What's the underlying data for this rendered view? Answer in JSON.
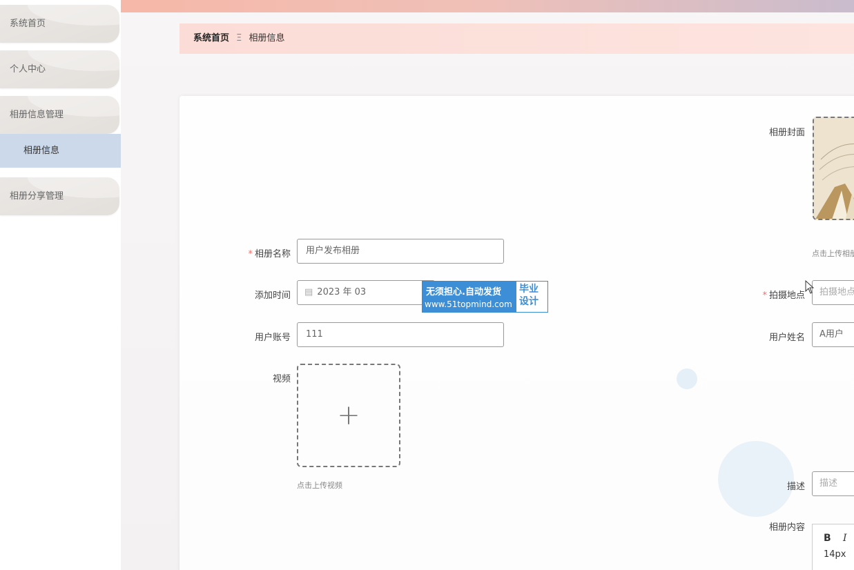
{
  "sidebar": {
    "items": [
      {
        "label": "系统首页"
      },
      {
        "label": "个人中心",
        "chevron": "chevron-down-icon"
      },
      {
        "label": "相册信息管理",
        "chevron": "chevron-up-icon"
      },
      {
        "label": "相册分享管理",
        "chevron": "chevron-down-icon"
      }
    ],
    "active_sub": "相册信息"
  },
  "breadcrumb": {
    "home": "系统首页",
    "separator": "Ξ",
    "current": "相册信息"
  },
  "form": {
    "name_label": "相册名称",
    "name_value": "用户发布相册",
    "time_label": "添加时间",
    "time_value": "2023 年 03",
    "account_label": "用户账号",
    "account_value": "111",
    "video_label": "视频",
    "video_hint": "点击上传视频",
    "cover_label": "相册封面",
    "cover_hint": "点击上传相册",
    "location_label": "拍摄地点",
    "location_placeholder": "拍摄地点",
    "username_label": "用户姓名",
    "username_value": "A用户",
    "desc_label": "描述",
    "desc_placeholder": "描述",
    "content_label": "相册内容",
    "editor": {
      "bold": "B",
      "italic": "I",
      "font_size": "14px"
    }
  },
  "watermark": {
    "line1": "无须担心.自动发货",
    "line2": "www.51topmind.com",
    "right1": "毕业",
    "right2": "设计"
  },
  "colors": {
    "accent": "#cbd9ea",
    "required": "#f56c6c",
    "watermark": "#3c8fd6"
  }
}
